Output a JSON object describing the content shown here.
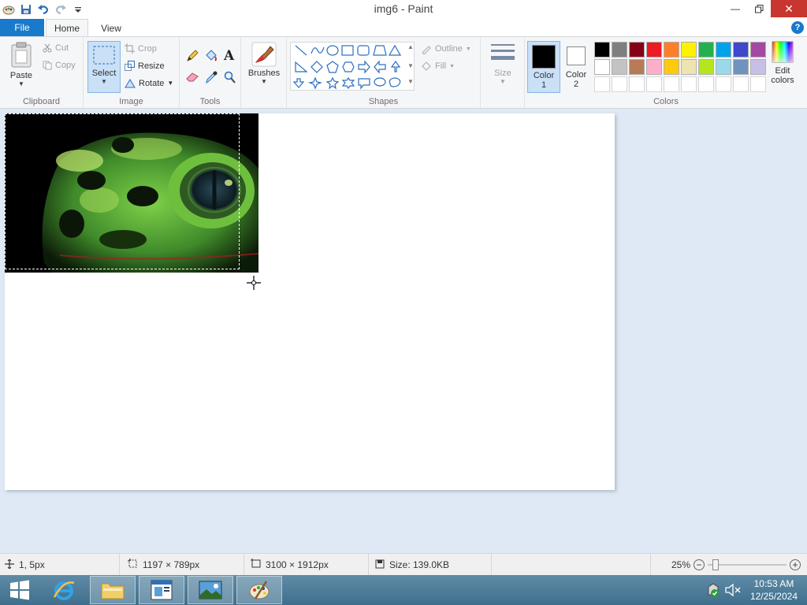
{
  "window": {
    "title": "img6 - Paint"
  },
  "tabs": {
    "file": "File",
    "home": "Home",
    "view": "View"
  },
  "clipboard": {
    "paste": "Paste",
    "cut": "Cut",
    "copy": "Copy",
    "label": "Clipboard"
  },
  "image": {
    "select": "Select",
    "crop": "Crop",
    "resize": "Resize",
    "rotate": "Rotate",
    "label": "Image"
  },
  "tools": {
    "label": "Tools"
  },
  "brushes": {
    "label": "Brushes"
  },
  "shapes": {
    "outline": "Outline",
    "fill": "Fill",
    "label": "Shapes"
  },
  "size": {
    "label": "Size"
  },
  "colors": {
    "color1_line1": "Color",
    "color1_line2": "1",
    "color2_line1": "Color",
    "color2_line2": "2",
    "edit_line1": "Edit",
    "edit_line2": "colors",
    "label": "Colors",
    "color1_value": "#000000",
    "color2_value": "#ffffff",
    "palette_row1": [
      "#000000",
      "#7f7f7f",
      "#880015",
      "#ed1c24",
      "#ff7f27",
      "#fff200",
      "#22b14c",
      "#00a2e8",
      "#3f48cc",
      "#a349a4"
    ],
    "palette_row2": [
      "#ffffff",
      "#c3c3c3",
      "#b97a57",
      "#ffaec9",
      "#ffc90e",
      "#efe4b0",
      "#b5e61d",
      "#99d9ea",
      "#7092be",
      "#c8bfe7"
    ],
    "palette_row3": [
      "#ffffff",
      "#ffffff",
      "#ffffff",
      "#ffffff",
      "#ffffff",
      "#ffffff",
      "#ffffff",
      "#ffffff",
      "#ffffff",
      "#ffffff"
    ]
  },
  "status": {
    "cursor_pos": "1, 5px",
    "selection_size": "1197 × 789px",
    "image_size": "3100 × 1912px",
    "file_size": "Size: 139.0KB",
    "zoom": "25%",
    "zoom_fraction": 0.06
  },
  "taskbar": {
    "time": "10:53 AM",
    "date": "12/25/2024"
  }
}
